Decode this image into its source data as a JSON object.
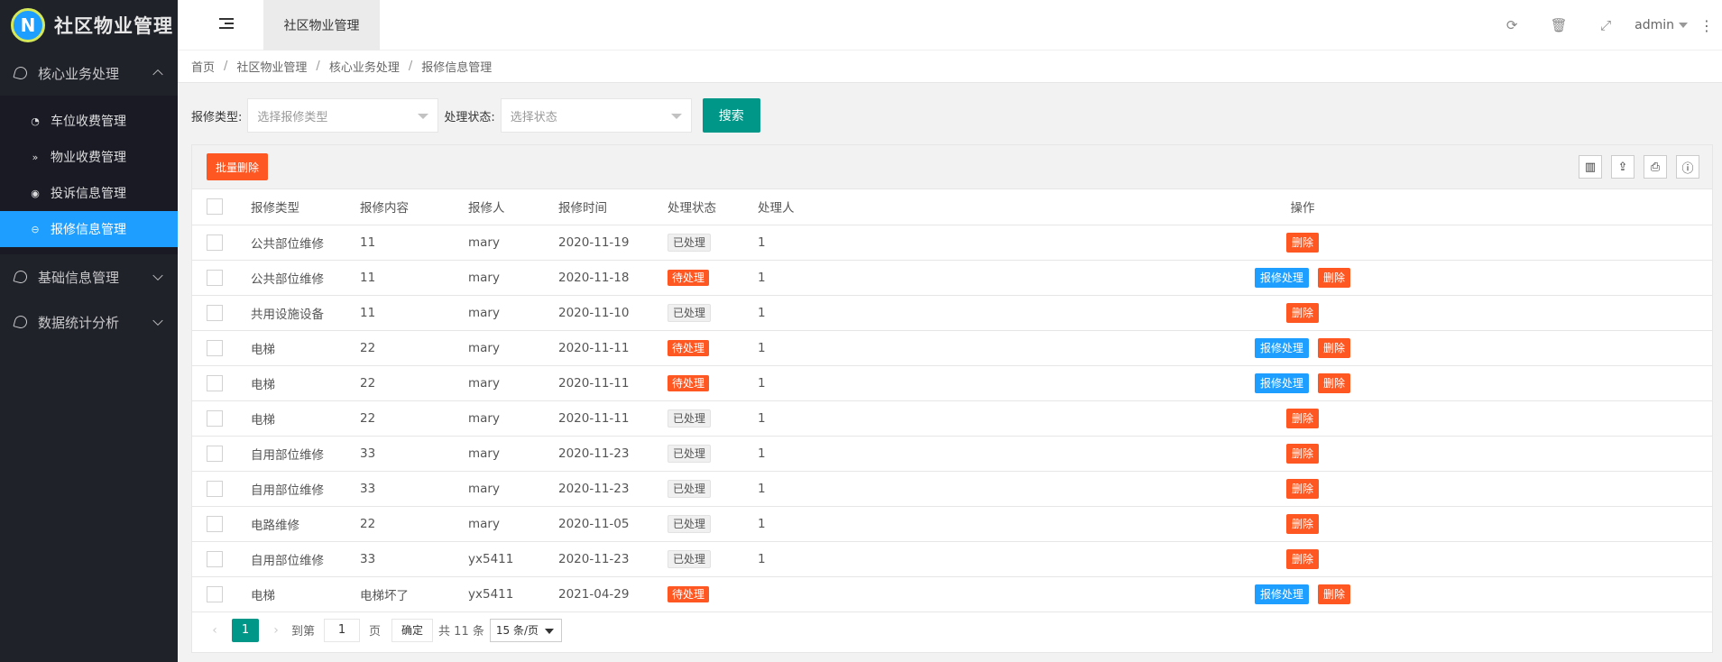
{
  "app": {
    "logo_letter": "N",
    "title": "社区物业管理"
  },
  "sidebar": {
    "groups": [
      {
        "label": "核心业务处理",
        "expanded": true,
        "items": [
          {
            "label": "车位收费管理",
            "icon": "dashboard-icon"
          },
          {
            "label": "物业收费管理",
            "icon": "double-chevron-icon"
          },
          {
            "label": "投诉信息管理",
            "icon": "target-icon"
          },
          {
            "label": "报修信息管理",
            "icon": "minus-circle-icon",
            "active": true
          }
        ]
      },
      {
        "label": "基础信息管理",
        "expanded": false
      },
      {
        "label": "数据统计分析",
        "expanded": false
      }
    ]
  },
  "header": {
    "tab": "社区物业管理",
    "user": "admin",
    "icons": [
      "refresh-icon",
      "trash-icon",
      "fullscreen-icon",
      "more-icon"
    ]
  },
  "breadcrumb": [
    "首页",
    "社区物业管理",
    "核心业务处理",
    "报修信息管理"
  ],
  "search": {
    "type_label": "报修类型:",
    "type_placeholder": "选择报修类型",
    "status_label": "处理状态:",
    "status_placeholder": "选择状态",
    "button": "搜索"
  },
  "toolbar": {
    "batch_delete": "批量删除"
  },
  "table": {
    "columns": [
      "报修类型",
      "报修内容",
      "报修人",
      "报修时间",
      "处理状态",
      "处理人",
      "操作"
    ],
    "rows": [
      {
        "type": "公共部位维修",
        "content": "11",
        "person": "mary",
        "time": "2020-11-19",
        "status": "已处理",
        "handler": "1"
      },
      {
        "type": "公共部位维修",
        "content": "11",
        "person": "mary",
        "time": "2020-11-18",
        "status": "待处理",
        "handler": "1"
      },
      {
        "type": "共用设施设备",
        "content": "11",
        "person": "mary",
        "time": "2020-11-10",
        "status": "已处理",
        "handler": "1"
      },
      {
        "type": "电梯",
        "content": "22",
        "person": "mary",
        "time": "2020-11-11",
        "status": "待处理",
        "handler": "1"
      },
      {
        "type": "电梯",
        "content": "22",
        "person": "mary",
        "time": "2020-11-11",
        "status": "待处理",
        "handler": "1"
      },
      {
        "type": "电梯",
        "content": "22",
        "person": "mary",
        "time": "2020-11-11",
        "status": "已处理",
        "handler": "1"
      },
      {
        "type": "自用部位维修",
        "content": "33",
        "person": "mary",
        "time": "2020-11-23",
        "status": "已处理",
        "handler": "1"
      },
      {
        "type": "自用部位维修",
        "content": "33",
        "person": "mary",
        "time": "2020-11-23",
        "status": "已处理",
        "handler": "1"
      },
      {
        "type": "电路维修",
        "content": "22",
        "person": "mary",
        "time": "2020-11-05",
        "status": "已处理",
        "handler": "1"
      },
      {
        "type": "自用部位维修",
        "content": "33",
        "person": "yx5411",
        "time": "2020-11-23",
        "status": "已处理",
        "handler": "1"
      },
      {
        "type": "电梯",
        "content": "电梯坏了",
        "person": "yx5411",
        "time": "2021-04-29",
        "status": "待处理",
        "handler": ""
      }
    ],
    "op_process": "报修处理",
    "op_delete": "删除"
  },
  "pager": {
    "current": "1",
    "goto_label": "到第",
    "goto_value": "1",
    "page_label": "页",
    "confirm": "确定",
    "total": "共 11 条",
    "page_size": "15 条/页"
  },
  "colors": {
    "sidebar_bg": "#20222a",
    "active_blue": "#1E9FFF",
    "primary_green": "#009688",
    "danger_orange": "#FF5722"
  }
}
